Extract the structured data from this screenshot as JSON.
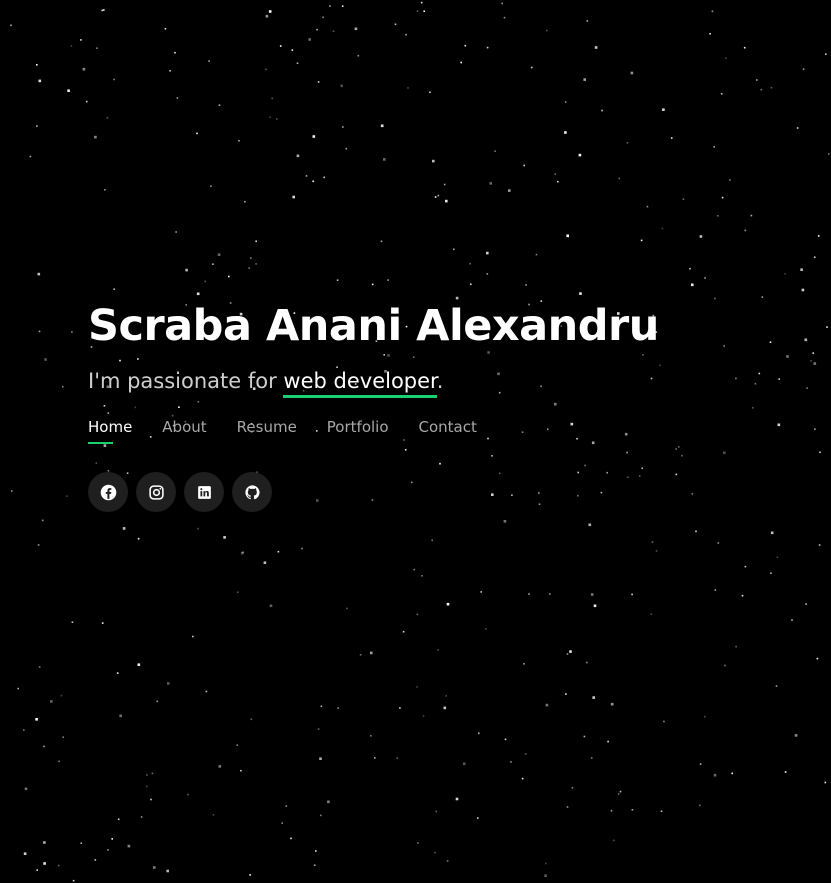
{
  "hero": {
    "name": "Scraba Anani Alexandru",
    "tagline_prefix": "I'm passionate for ",
    "tagline_typed": "web developer",
    "tagline_suffix": "."
  },
  "nav": {
    "items": [
      {
        "label": "Home",
        "active": true
      },
      {
        "label": "About",
        "active": false
      },
      {
        "label": "Resume",
        "active": false
      },
      {
        "label": "Portfolio",
        "active": false
      },
      {
        "label": "Contact",
        "active": false
      }
    ]
  },
  "social": {
    "icons": [
      "facebook-icon",
      "instagram-icon",
      "linkedin-icon",
      "github-icon"
    ]
  },
  "colors": {
    "background": "#000000",
    "accent": "#18d26e",
    "text": "#ffffff",
    "muted": "#a8a8a8",
    "social_bg": "#1f1f1f"
  }
}
